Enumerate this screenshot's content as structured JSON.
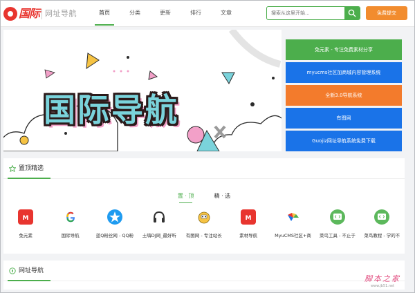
{
  "header": {
    "logo_main": "国际",
    "logo_sub": "网址导航",
    "nav": [
      {
        "label": "首页",
        "active": true
      },
      {
        "label": "分类",
        "active": false
      },
      {
        "label": "更新",
        "active": false
      },
      {
        "label": "排行",
        "active": false
      },
      {
        "label": "文章",
        "active": false
      }
    ],
    "search_placeholder": "搜索从这里开始...",
    "submit_label": "免费提交"
  },
  "banner": {
    "title": "国际导航"
  },
  "side_links": [
    {
      "label": "免元素 - 专注免费素材分享",
      "color": "#4cae4c"
    },
    {
      "label": "myucms社区加商城内容管理系统",
      "color": "#1a73e8"
    },
    {
      "label": "全新3.0导航系统",
      "color": "#f37b2c"
    },
    {
      "label": "有图网",
      "color": "#1a73e8"
    },
    {
      "label": "Guojiz网址导航系统免费下载",
      "color": "#1a73e8"
    }
  ],
  "picks": {
    "title": "置顶精选",
    "tabs": [
      {
        "label": "置 · 顶",
        "active": true
      },
      {
        "label": "精 · 选",
        "active": false
      }
    ],
    "sites": [
      {
        "name": "免元素",
        "icon": "m-logo-icon",
        "color": "#e8352f"
      },
      {
        "name": "国际导航",
        "icon": "google-g-icon",
        "color": "#ffffff"
      },
      {
        "name": "蓝Q粉丝网 - QQ粉",
        "icon": "star-badge-icon",
        "color": "#1e9bf0"
      },
      {
        "name": "土嗨DJ网_最好听",
        "icon": "headphones-icon",
        "color": "#ffffff"
      },
      {
        "name": "有图网 - 专注站长",
        "icon": "mascot-icon",
        "color": "#f6c343"
      },
      {
        "name": "素材导航",
        "icon": "m-logo-icon",
        "color": "#e8352f"
      },
      {
        "name": "MyuCMS社区+商",
        "icon": "myu-logo-icon",
        "color": "#ffffff"
      },
      {
        "name": "菜鸟工具 - 不止于",
        "icon": "code-bubble-icon",
        "color": "#5cb85c"
      },
      {
        "name": "菜鸟教程 - 学的不",
        "icon": "code-bubble-icon",
        "color": "#5cb85c"
      }
    ]
  },
  "nav_section": {
    "title": "网址导航"
  },
  "watermark": {
    "main": "脚本之家",
    "sub": "www.jb51.net"
  }
}
